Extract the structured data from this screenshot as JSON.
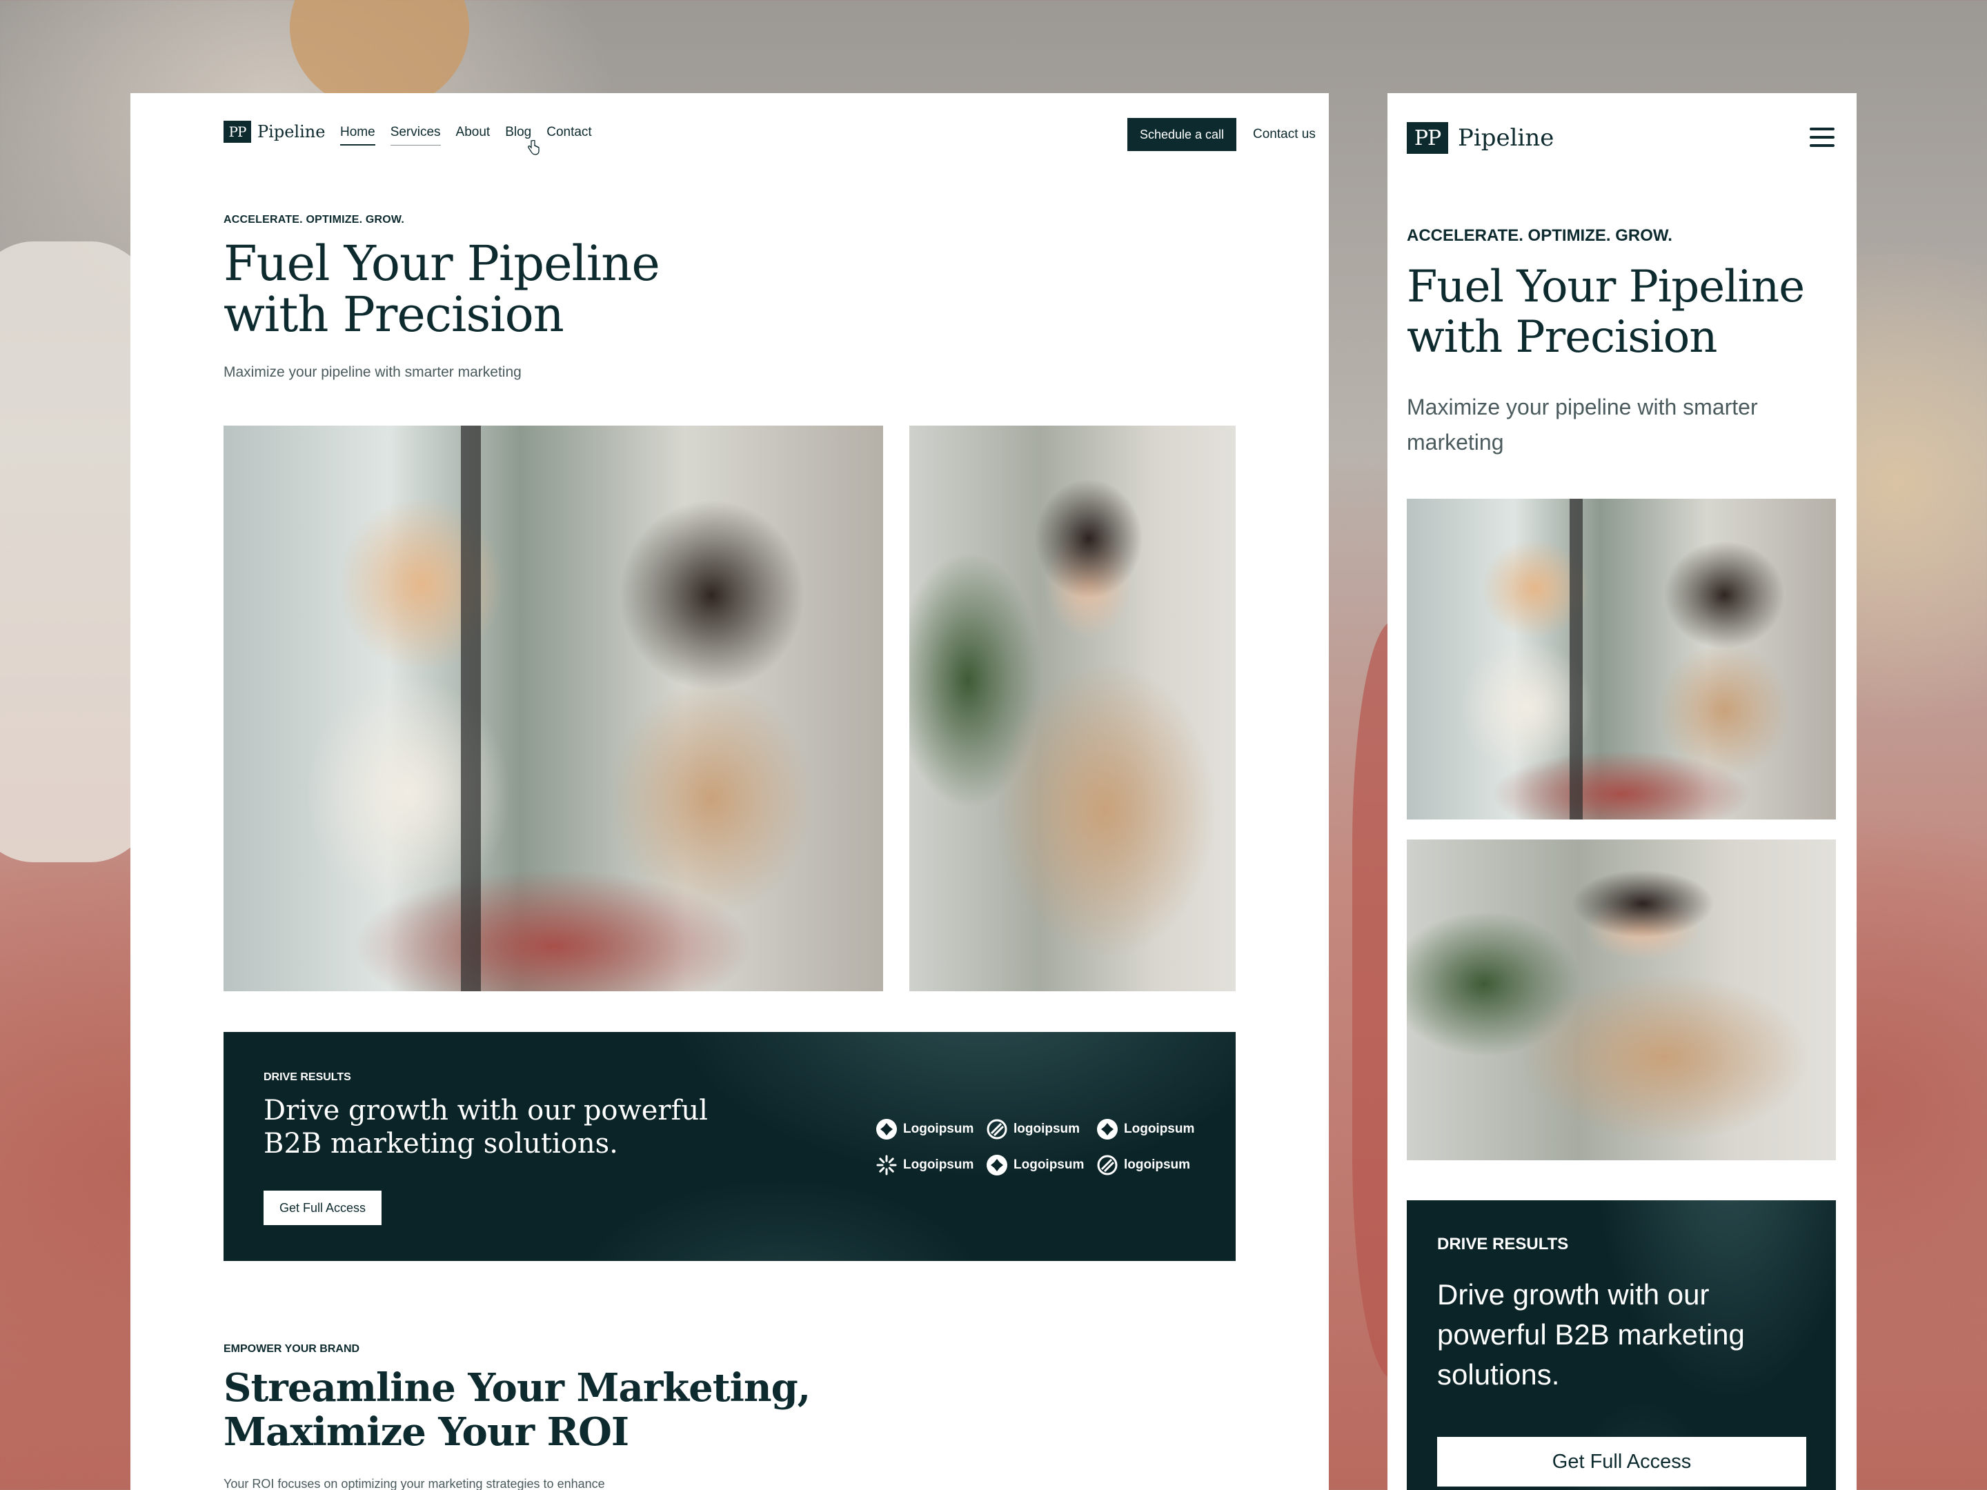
{
  "brand": {
    "mark": "PP",
    "name": "Pipeline",
    "colors": {
      "primary": "#0d2a2e",
      "banner": "#0b2428",
      "white": "#ffffff"
    }
  },
  "nav": {
    "links": [
      "Home",
      "Services",
      "About",
      "Blog",
      "Contact"
    ],
    "active": "Home",
    "hovered": "Services",
    "cta_primary": "Schedule a call",
    "cta_secondary": "Contact us"
  },
  "hero": {
    "eyebrow": "ACCELERATE. OPTIMIZE. GROW.",
    "title_line1": "Fuel Your Pipeline",
    "title_line2": "with Precision",
    "subtitle": "Maximize your pipeline with smarter marketing"
  },
  "banner": {
    "eyebrow": "DRIVE RESULTS",
    "title_line1": "Drive growth with our powerful",
    "title_line2": "B2B marketing solutions.",
    "title_full": "Drive growth with our powerful B2B marketing solutions.",
    "button": "Get Full Access",
    "logos": [
      {
        "name": "Logoipsum",
        "icon": "diamond-cross-icon"
      },
      {
        "name": "logoipsum",
        "icon": "slashed-circle-icon"
      },
      {
        "name": "Logoipsum",
        "icon": "diamond-cross-icon"
      },
      {
        "name": "Logoipsum",
        "icon": "sunburst-icon"
      },
      {
        "name": "Logoipsum",
        "icon": "diamond-cross-icon"
      },
      {
        "name": "logoipsum",
        "icon": "slashed-circle-icon"
      }
    ]
  },
  "section2": {
    "eyebrow": "EMPOWER YOUR BRAND",
    "title_line1": "Streamline Your Marketing,",
    "title_line2": "Maximize Your ROI",
    "body": "Your ROI focuses on optimizing your marketing strategies to enhance"
  },
  "mobile": {
    "menu_icon": "hamburger-icon",
    "eyebrow": "ACCELERATE. OPTIMIZE. GROW."
  }
}
